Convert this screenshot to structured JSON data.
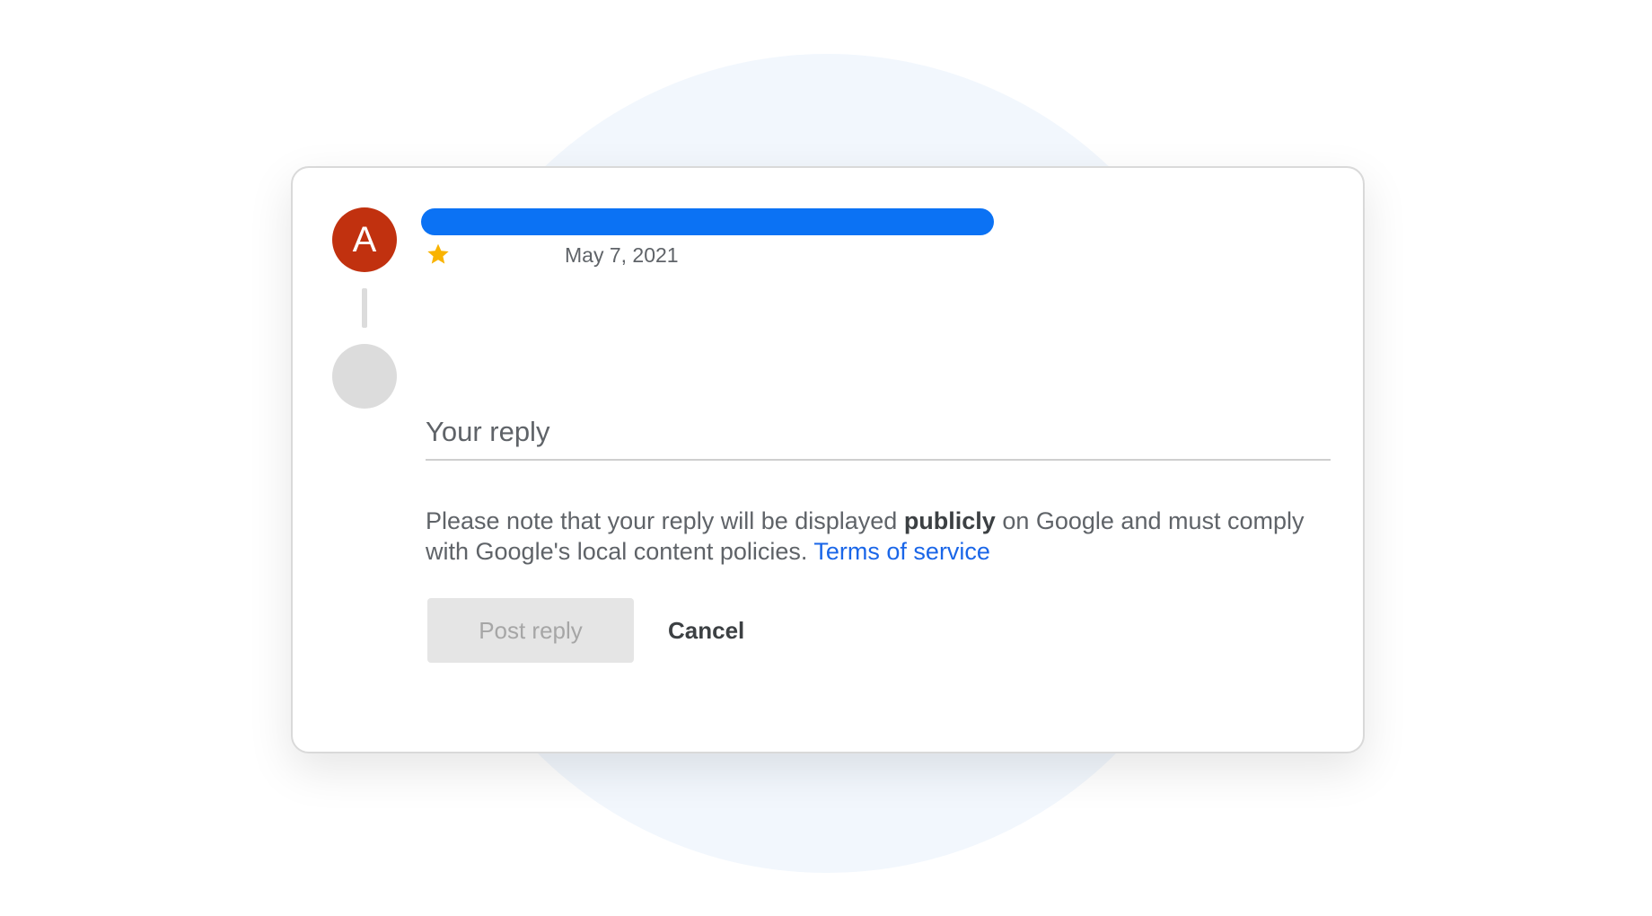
{
  "review": {
    "avatar_initial": "A",
    "date": "May 7, 2021",
    "rating_icon": "star-icon",
    "star_color": "#f9b300",
    "avatar_color": "#c1310f",
    "name_bar_color": "#0b72f4"
  },
  "reply": {
    "placeholder": "Your reply",
    "notice_before": "Please note that your reply will be displayed ",
    "notice_bold": "publicly",
    "notice_after": " on Google and must comply with Google's local content policies. ",
    "terms_link": "Terms of service",
    "post_label": "Post reply",
    "cancel_label": "Cancel"
  }
}
